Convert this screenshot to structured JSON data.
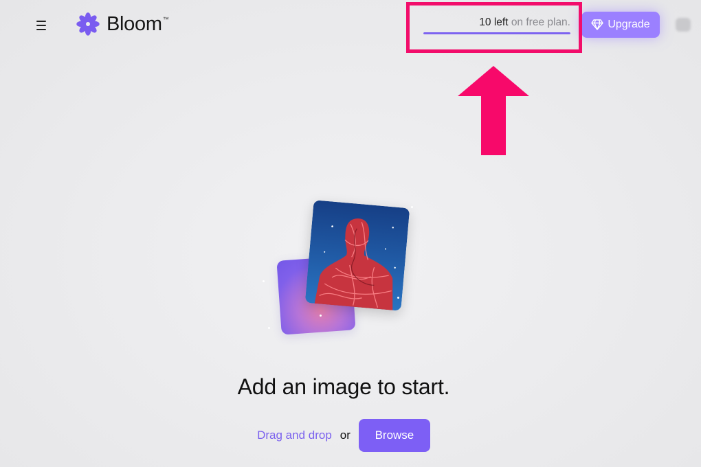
{
  "header": {
    "brand": "Bloom",
    "trademark": "™",
    "credits": {
      "count_label": "10 left",
      "suffix": "on free plan.",
      "remaining_fraction": 1.0
    },
    "upgrade_label": "Upgrade"
  },
  "main": {
    "headline": "Add an image to start.",
    "drag_label": "Drag and drop",
    "or_label": "or",
    "browse_label": "Browse"
  },
  "colors": {
    "accent": "#7d5ff5",
    "upgrade": "#9b80ff",
    "annotation": "#f20d6b"
  },
  "icons": [
    "menu-icon",
    "bloom-logo-icon",
    "diamond-icon"
  ]
}
